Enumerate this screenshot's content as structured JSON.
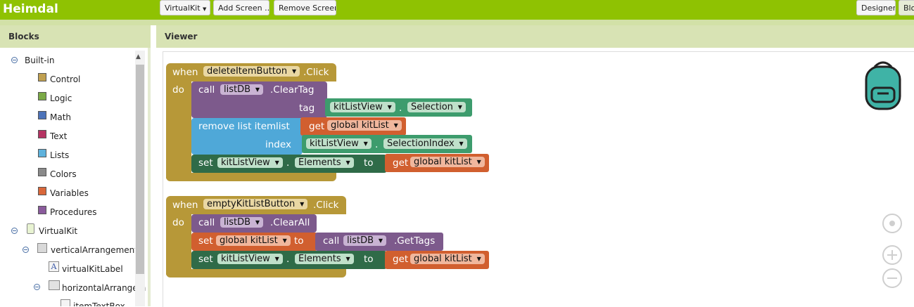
{
  "app": {
    "title": "Heimdal"
  },
  "toolbar": {
    "screen_select": "VirtualKit",
    "add_screen": "Add Screen ...",
    "remove_screen": "Remove Screen",
    "designer": "Designer",
    "blocks": "Blocks"
  },
  "left_panel": {
    "header": "Blocks",
    "builtin": "Built-in",
    "categories": [
      {
        "label": "Control",
        "color": "#c0a050"
      },
      {
        "label": "Logic",
        "color": "#7ba946"
      },
      {
        "label": "Math",
        "color": "#4d73b9"
      },
      {
        "label": "Text",
        "color": "#b53362"
      },
      {
        "label": "Lists",
        "color": "#5fb2dc"
      },
      {
        "label": "Colors",
        "color": "#8a8a8a"
      },
      {
        "label": "Variables",
        "color": "#d9673a"
      },
      {
        "label": "Procedures",
        "color": "#8a5b9c"
      }
    ],
    "components": [
      {
        "label": "VirtualKit"
      },
      {
        "label": "verticalArrangement"
      },
      {
        "label": "virtualKitLabel"
      },
      {
        "label": "horizontalArrangem"
      },
      {
        "label": "itemTextBox"
      }
    ]
  },
  "viewer": {
    "header": "Viewer",
    "event1": {
      "when": "when",
      "do": "do",
      "component": "deleteItemButton",
      "event": ".Click",
      "call": "call",
      "db": "listDB",
      "method_clear_tag": ".ClearTag",
      "tag": "tag",
      "list_view": "kitListView",
      "selection": "Selection",
      "remove": "remove list item",
      "list": "list",
      "get": "get",
      "global_kitlist": "global kitList",
      "index": "index",
      "selection_index": "SelectionIndex",
      "set": "set",
      "elements": "Elements",
      "to": "to",
      "dot": "."
    },
    "event2": {
      "when": "when",
      "do": "do",
      "component": "emptyKitListButton",
      "event": ".Click",
      "call": "call",
      "db": "listDB",
      "method_clear_all": ".ClearAll",
      "set": "set",
      "global_kitlist": "global kitList",
      "to": "to",
      "method_get_tags": ".GetTags",
      "list_view": "kitListView",
      "elements": "Elements",
      "get": "get",
      "dot": "."
    }
  },
  "colors": {
    "topbar": "#8fc202",
    "event": "#b79838",
    "component_method": "#7d5a8c",
    "list": "#4fa8d8",
    "variable": "#d15f2f",
    "component_setter": "#2f6b48",
    "component_getter": "#3d9c6d"
  }
}
